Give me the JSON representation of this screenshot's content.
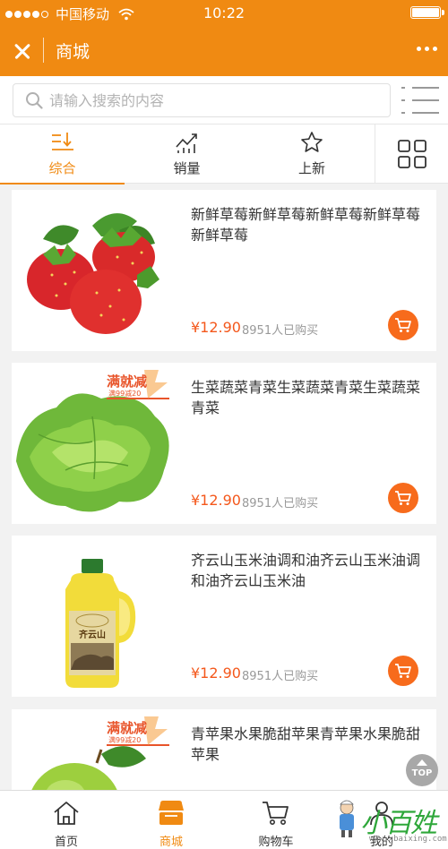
{
  "status_bar": {
    "carrier": "中国移动",
    "time": "10:22"
  },
  "titlebar": {
    "title": "商城"
  },
  "search": {
    "placeholder": "请输入搜索的内容"
  },
  "tabs": [
    {
      "label": "综合",
      "icon": "sort-icon",
      "active": true
    },
    {
      "label": "销量",
      "icon": "trend-chart-icon",
      "active": false
    },
    {
      "label": "上新",
      "icon": "star-icon",
      "active": false
    }
  ],
  "products": [
    {
      "name": "新鲜草莓新鲜草莓新鲜草莓新鲜草莓新鲜草莓",
      "price": "¥12.90",
      "sold": "8951人已购买",
      "image": "strawberry-image",
      "promo": false
    },
    {
      "name": "生菜蔬菜青菜生菜蔬菜青菜生菜蔬菜青菜",
      "price": "¥12.90",
      "sold": "8951人已购买",
      "image": "lettuce-image",
      "promo": true
    },
    {
      "name": "齐云山玉米油调和油齐云山玉米油调和油齐云山玉米油",
      "price": "¥12.90",
      "sold": "8951人已购买",
      "image": "corn-oil-bottle-image",
      "promo": false
    },
    {
      "name": "青苹果水果脆甜苹果青苹果水果脆甜苹果",
      "price": "",
      "sold": "",
      "image": "green-apple-image",
      "promo": true
    }
  ],
  "promo_badge": {
    "main": "满就减",
    "sub": "满99减20"
  },
  "oil_label": "齐云山",
  "back_to_top": "TOP",
  "bottom_nav": [
    {
      "label": "首页",
      "icon": "home-icon",
      "active": false
    },
    {
      "label": "商城",
      "icon": "store-icon",
      "active": true
    },
    {
      "label": "购物车",
      "icon": "cart-icon",
      "active": false
    },
    {
      "label": "我的",
      "icon": "user-icon",
      "active": false
    }
  ],
  "watermark": {
    "brand": "小百姓",
    "url": "www.xbaixing.com"
  },
  "colors": {
    "brand_orange": "#f08a12",
    "price_red": "#f4581c",
    "cart_button": "#f76b1c"
  }
}
